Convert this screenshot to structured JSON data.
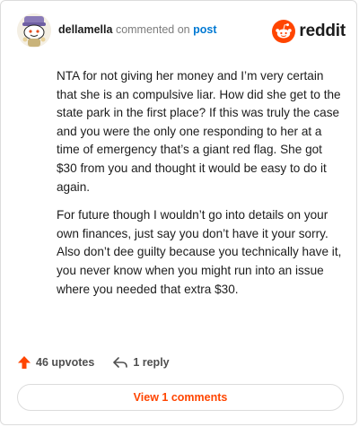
{
  "comment": {
    "username": "dellamella",
    "action_text": "commented on",
    "post_link": "post",
    "paragraphs": [
      "NTA for not giving her money and I’m very certain that she is an compulsive liar. How did she get to the state park in the first place? If this was truly the case and you were the only one responding to her at a time of emergency that’s a giant red flag. She got $30 from you and thought it would be easy to do it again.",
      "For future though I wouldn’t go into details on your own finances, just say you don’t have it your sorry. Also don’t dee guilty because you technically have it, you never know when you might run into an issue where you needed that extra $30."
    ]
  },
  "brand": {
    "name": "reddit",
    "icon": "reddit-logo-icon",
    "color": "#ff4500"
  },
  "actions": {
    "upvotes_label": "46 upvotes",
    "upvote_icon": "upvote-arrow-icon",
    "reply_label": "1 reply",
    "reply_icon": "reply-icon"
  },
  "footer": {
    "view_comments_label": "View 1 comments"
  },
  "colors": {
    "accent": "#ff4500",
    "link": "#0079d3",
    "text": "#1c1c1c",
    "muted": "#7c7c7c"
  }
}
